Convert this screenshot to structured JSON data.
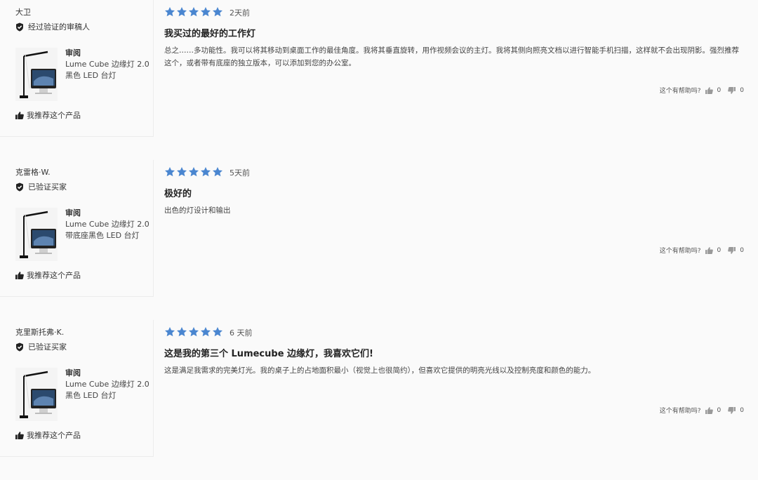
{
  "reviews": [
    {
      "author": "大卫",
      "badge": "经过验证的审稿人",
      "product": {
        "heading": "审阅",
        "line1": "Lume Cube 边缘灯 2.0",
        "line2": "黑色 LED 台灯"
      },
      "recommend": "我推荐这个产品",
      "rating": 5,
      "date": "2天前",
      "title": "我买过的最好的工作灯",
      "body": "总之……多功能性。我可以将其移动到桌面工作的最佳角度。我将其垂直旋转，用作视频会议的主灯。我将其侧向照亮文档以进行智能手机扫描，这样就不会出现阴影。强烈推荐这个，或者带有底座的独立版本，可以添加到您的办公室。",
      "helpful_label": "这个有帮助吗?",
      "up": "0",
      "down": "0"
    },
    {
      "author": "克雷格·W.",
      "badge": "已验证买家",
      "product": {
        "heading": "审阅",
        "line1": "Lume Cube 边缘灯 2.0",
        "line2": "带底座黑色 LED 台灯"
      },
      "recommend": "我推荐这个产品",
      "rating": 5,
      "date": "5天前",
      "title": "极好的",
      "body": "出色的灯设计和输出",
      "helpful_label": "这个有帮助吗?",
      "up": "0",
      "down": "0"
    },
    {
      "author": "克里斯托弗·K.",
      "badge": "已验证买家",
      "product": {
        "heading": "审阅",
        "line1": "Lume Cube 边缘灯 2.0",
        "line2": "黑色 LED 台灯"
      },
      "recommend": "我推荐这个产品",
      "rating": 5,
      "date": "6 天前",
      "title": "这是我的第三个 Lumecube 边缘灯，我喜欢它们!",
      "body": "这是满足我需求的完美灯光。我的桌子上的占地面积最小（视觉上也很简约），但喜欢它提供的明亮光线以及控制亮度和颜色的能力。",
      "helpful_label": "这个有帮助吗?",
      "up": "0",
      "down": "0"
    }
  ],
  "colors": {
    "star": "#4a86d0",
    "text": "#333333"
  },
  "icons": {
    "badge": "shield-check-icon",
    "thumb_up": "thumbs-up-icon",
    "thumb_down": "thumbs-down-icon",
    "star": "star-icon"
  }
}
